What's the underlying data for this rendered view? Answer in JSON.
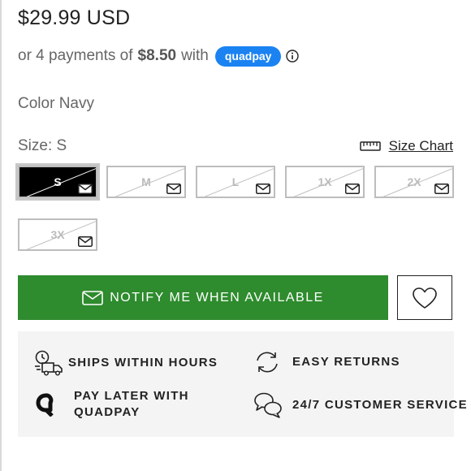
{
  "price": "$29.99 USD",
  "installments": {
    "prefix": "or 4 payments of",
    "amount": "$8.50",
    "suffix": "with",
    "provider_badge": "quadpay"
  },
  "color": {
    "label": "Color",
    "value": "Navy"
  },
  "size": {
    "label": "Size:",
    "value": "S",
    "chart_link": "Size Chart"
  },
  "size_options": [
    {
      "label": "S",
      "selected": true,
      "available": false
    },
    {
      "label": "M",
      "selected": false,
      "available": false
    },
    {
      "label": "L",
      "selected": false,
      "available": false
    },
    {
      "label": "1X",
      "selected": false,
      "available": false
    },
    {
      "label": "2X",
      "selected": false,
      "available": false
    },
    {
      "label": "3X",
      "selected": false,
      "available": false
    }
  ],
  "notify_button": "NOTIFY ME WHEN AVAILABLE",
  "features": [
    {
      "icon": "shipping-clock-truck-icon",
      "line1": "SHIPS WITHIN HOURS",
      "line2": ""
    },
    {
      "icon": "returns-arrows-icon",
      "line1": "EASY RETURNS",
      "line2": ""
    },
    {
      "icon": "quadpay-logo-icon",
      "line1": "PAY LATER WITH",
      "line2": "QUADPAY"
    },
    {
      "icon": "chat-bubbles-icon",
      "line1": "24/7 CUSTOMER SERVICE",
      "line2": ""
    }
  ],
  "colors": {
    "accent_green": "#2e8b2e",
    "quadpay_blue": "#1b82f2",
    "feature_bg": "#f4f4f4"
  }
}
